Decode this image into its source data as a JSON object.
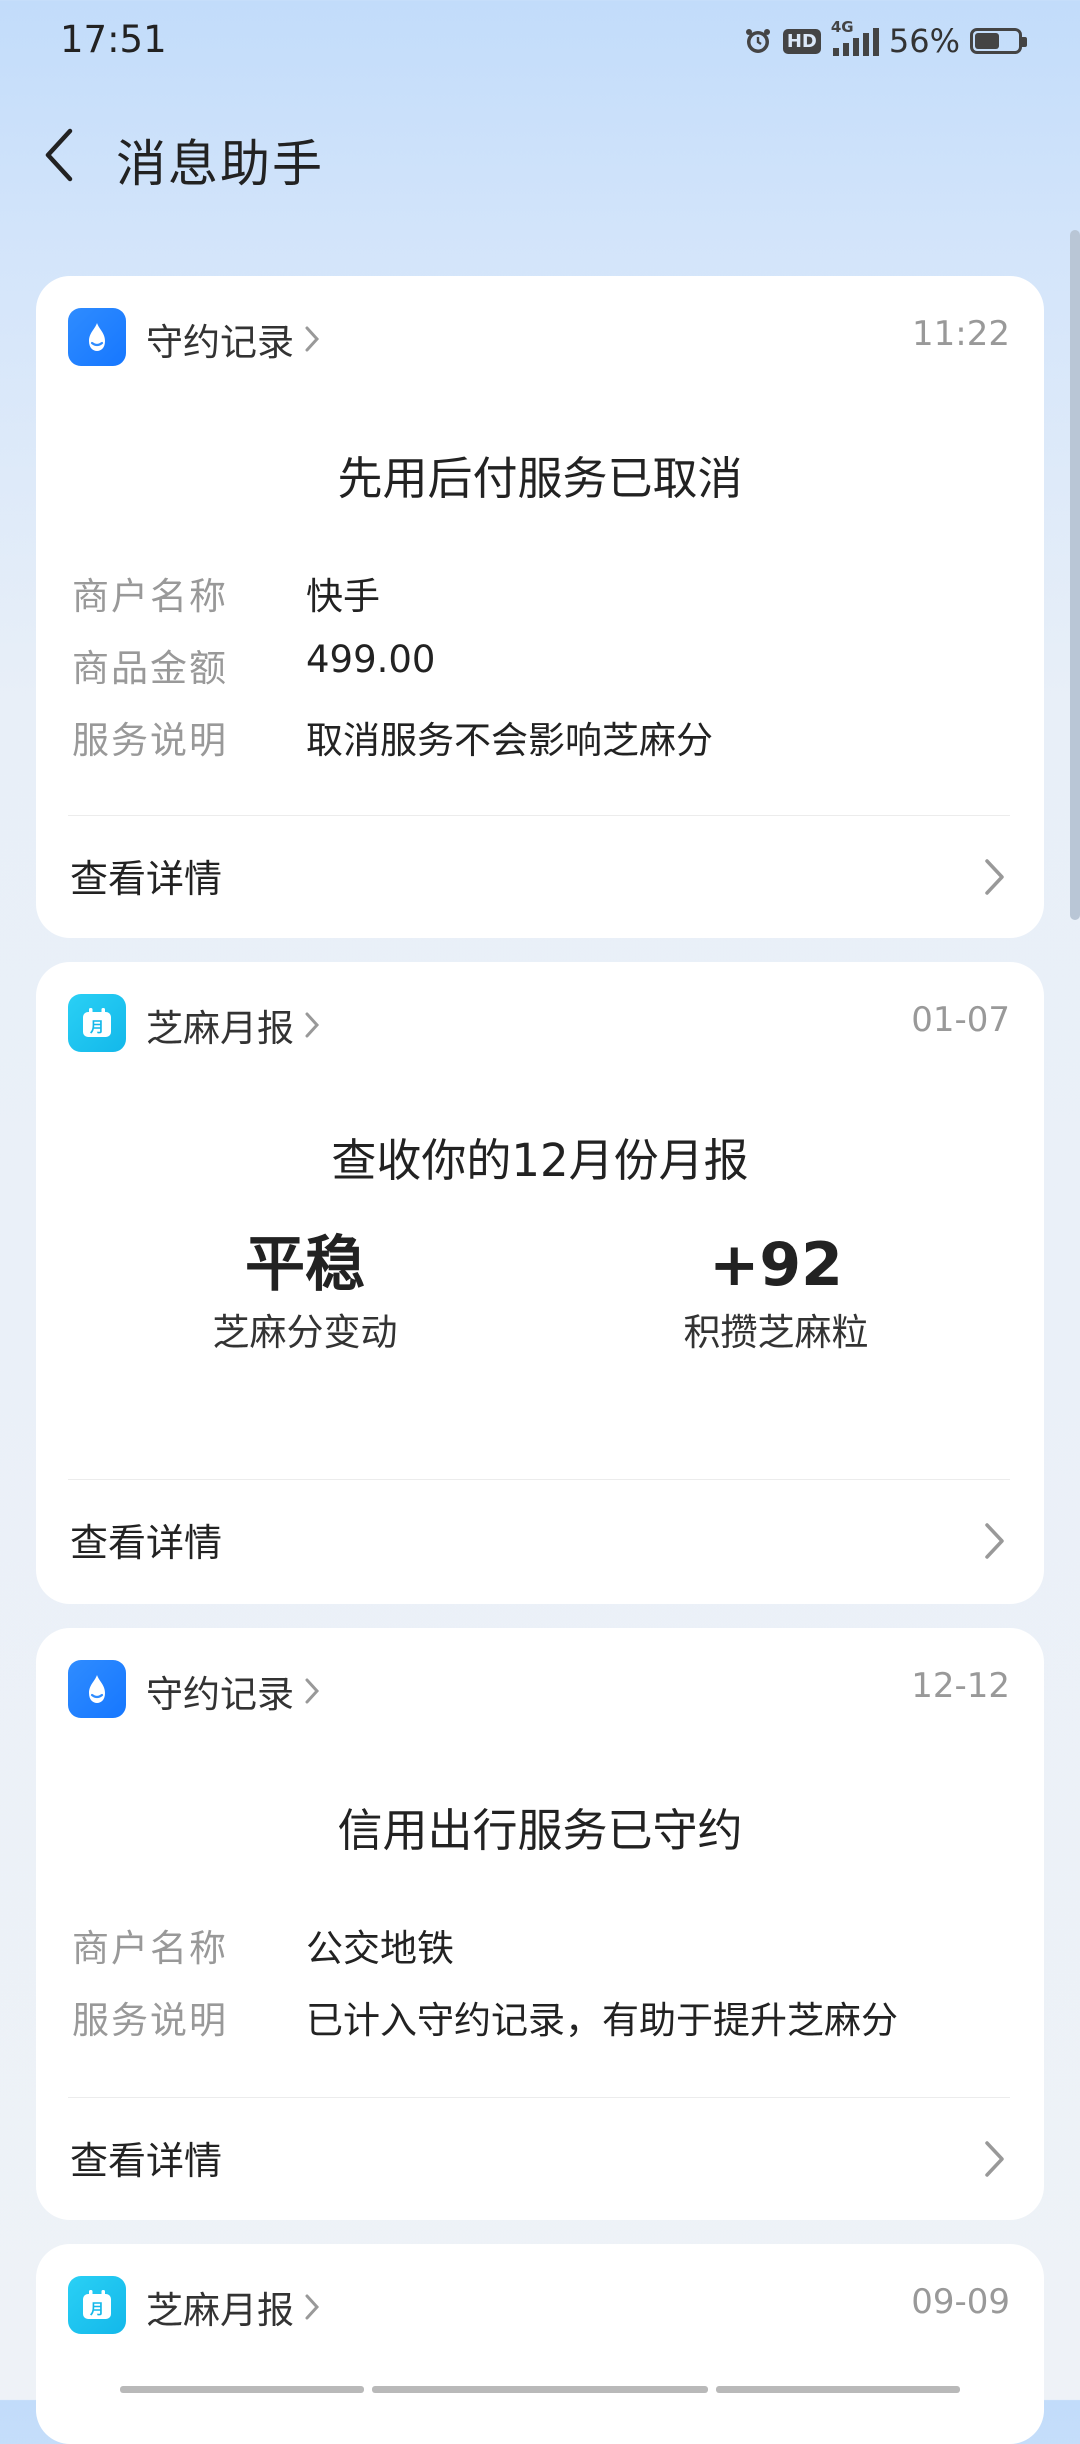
{
  "status_bar": {
    "time": "17:51",
    "alarm_icon": "alarm-clock-icon",
    "hd_label": "HD",
    "network_label": "4G",
    "battery_percent": "56%",
    "battery_level": 0.56
  },
  "header": {
    "back_icon": "chevron-left-icon",
    "title": "消息助手"
  },
  "cards": [
    {
      "source": "守约记录",
      "time": "11:22",
      "title": "先用后付服务已取消",
      "rows": [
        {
          "key": "商户名称",
          "value": "快手"
        },
        {
          "key": "商品金额",
          "value": "499.00"
        },
        {
          "key": "服务说明",
          "value": "取消服务不会影响芝麻分"
        }
      ],
      "detail_label": "查看详情"
    },
    {
      "source": "芝麻月报",
      "time": "01-07",
      "title": "查收你的12月份月报",
      "stats": [
        {
          "value": "平稳",
          "label": "芝麻分变动"
        },
        {
          "value": "+92",
          "label": "积攒芝麻粒"
        }
      ],
      "detail_label": "查看详情"
    },
    {
      "source": "守约记录",
      "time": "12-12",
      "title": "信用出行服务已守约",
      "rows": [
        {
          "key": "商户名称",
          "value": "公交地铁"
        },
        {
          "key": "服务说明",
          "value": "已计入守约记录，有助于提升芝麻分"
        }
      ],
      "detail_label": "查看详情"
    },
    {
      "source": "芝麻月报",
      "time": "09-09"
    }
  ],
  "colors": {
    "accent_blue": "#1677ff",
    "accent_cyan": "#13b8ea",
    "muted_text": "#999999"
  }
}
